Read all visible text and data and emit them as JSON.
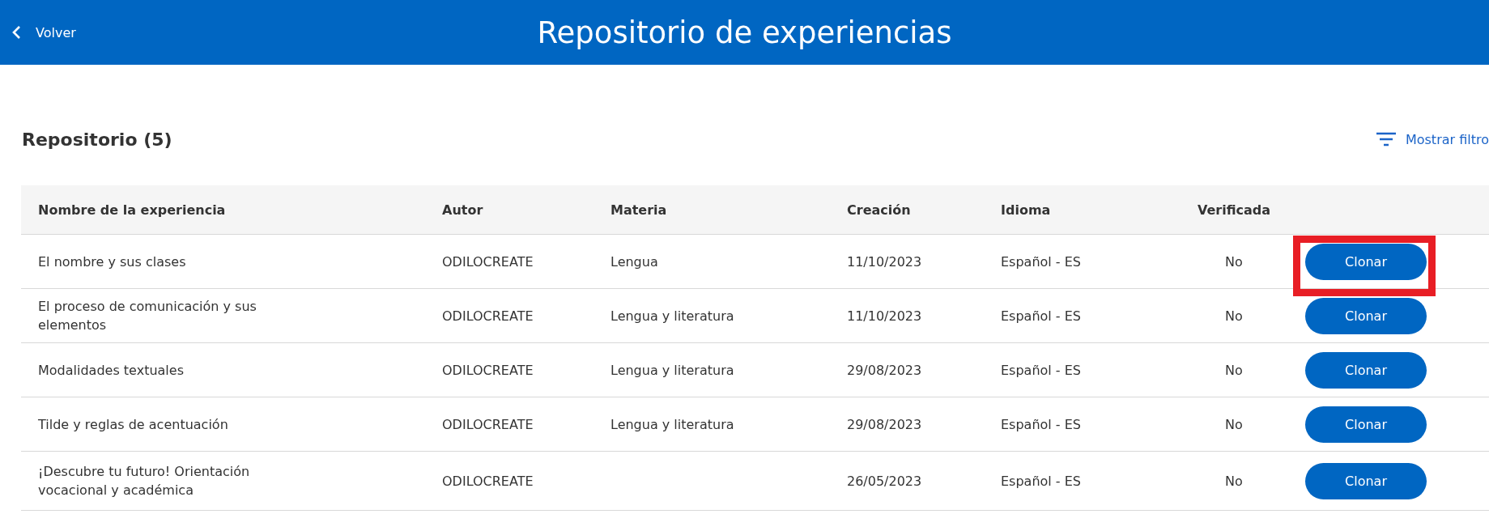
{
  "header": {
    "back": "Volver",
    "title": "Repositorio de experiencias"
  },
  "section": {
    "title": "Repositorio (5)",
    "filter_link": "Mostrar filtro"
  },
  "table": {
    "columns": [
      "Nombre de la experiencia",
      "Autor",
      "Materia",
      "Creación",
      "Idioma",
      "Verificada"
    ],
    "rows": [
      {
        "name": "El nombre y sus clases",
        "author": "ODILOCREATE",
        "subject": "Lengua",
        "created": "11/10/2023",
        "language": "Español - ES",
        "verified": "No",
        "action": "Clonar",
        "highlighted": true
      },
      {
        "name": "El proceso de comunicación y sus elementos",
        "author": "ODILOCREATE",
        "subject": "Lengua y literatura",
        "created": "11/10/2023",
        "language": "Español - ES",
        "verified": "No",
        "action": "Clonar",
        "highlighted": false
      },
      {
        "name": "Modalidades textuales",
        "author": "ODILOCREATE",
        "subject": "Lengua y literatura",
        "created": "29/08/2023",
        "language": "Español - ES",
        "verified": "No",
        "action": "Clonar",
        "highlighted": false
      },
      {
        "name": "Tilde y reglas de acentuación",
        "author": "ODILOCREATE",
        "subject": "Lengua y literatura",
        "created": "29/08/2023",
        "language": "Español - ES",
        "verified": "No",
        "action": "Clonar",
        "highlighted": false
      },
      {
        "name": "¡Descubre tu futuro! Orientación vocacional y académica",
        "author": "ODILOCREATE",
        "created": "26/05/2023",
        "language": "Español - ES",
        "verified": "No",
        "action": "Clonar",
        "highlighted": false
      }
    ]
  }
}
